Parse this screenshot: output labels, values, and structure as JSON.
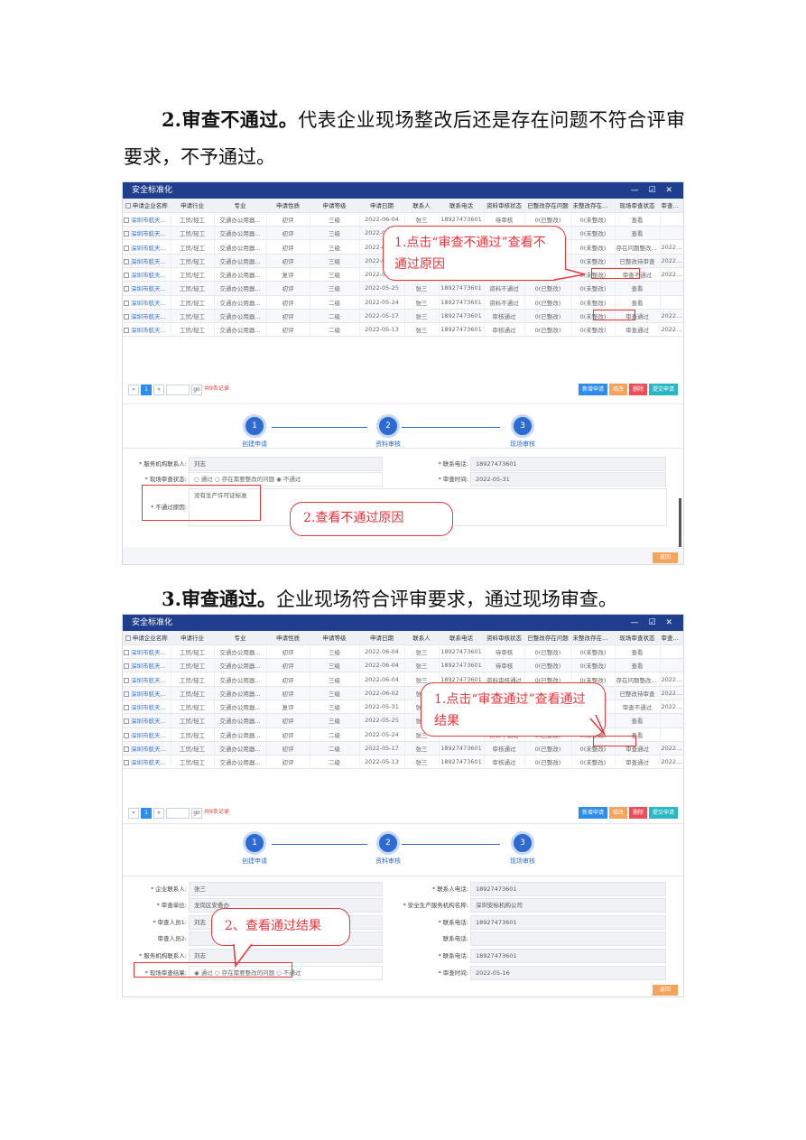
{
  "sections": [
    {
      "num": "2.",
      "bold": "审查不通过。",
      "text": "代表企业现场整改后还是存在问题不符合评审要求，不予通过。"
    },
    {
      "num": "3.",
      "bold": "审查通过。",
      "text": "企业现场符合评审要求，通过现场审查。"
    }
  ],
  "window": {
    "title": "安全标准化",
    "controls": "— ☑ ✕",
    "columns": [
      "申请企业名称",
      "申请行业",
      "专业",
      "申请性质",
      "申请等级",
      "申请日期",
      "联系人",
      "联系电话",
      "资料审核状态",
      "已整改存在问题",
      "未整改存在问题",
      "现场审查状态",
      "审查时间"
    ]
  },
  "table1": [
    [
      "深圳市航天科...",
      "工贸/轻工",
      "交通办公用器...",
      "初评",
      "三级",
      "2022-06-04",
      "张三",
      "18927473601",
      "待审核",
      "0(已整改)",
      "0(未整改)",
      "查看",
      "",
      "blue"
    ],
    [
      "深圳市航天科...",
      "工贸/轻工",
      "交通办公用器...",
      "初评",
      "三级",
      "2022-06-04",
      "张三",
      "18927473601",
      "待审核",
      "0(已整改)",
      "0(未整改)",
      "查看",
      "",
      "blue"
    ],
    [
      "深圳市航天科...",
      "工贸/轻工",
      "交通办公用器...",
      "初评",
      "三级",
      "2022-06-04",
      "张三",
      "18927473601",
      "资料审核通过",
      "0(已整改)",
      "0(未整改)",
      "存在问题整改不通",
      "2022-06-01",
      "blue"
    ],
    [
      "深圳市航天科...",
      "工贸/轻工",
      "交通办公用器...",
      "初评",
      "三级",
      "2022-06-02",
      "张三",
      "18927473601",
      "资料审核通过",
      "0(已整改)",
      "0(未整改)",
      "已整改待审查",
      "2022-06-01",
      "blue"
    ],
    [
      "深圳市航天科...",
      "工贸/轻工",
      "交通办公用器...",
      "复评",
      "三级",
      "2022-05-31",
      "张三",
      "18927473601",
      "资料审核通过",
      "0(已整改)",
      "0(未整改)",
      "审查不通过",
      "2022-05-31",
      "red"
    ],
    [
      "深圳市航天科...",
      "工贸/轻工",
      "交通办公用器...",
      "初评",
      "三级",
      "2022-05-25",
      "张三",
      "18927473601",
      "资料不通过",
      "0(已整改)",
      "0(未整改)",
      "查看",
      "",
      "blue"
    ],
    [
      "深圳市航天科...",
      "工贸/轻工",
      "交通办公用器...",
      "初评",
      "二级",
      "2022-05-24",
      "张三",
      "18927473601",
      "资料不通过",
      "0(已整改)",
      "0(未整改)",
      "查看",
      "",
      "blue"
    ],
    [
      "深圳市航天科...",
      "工贸/轻工",
      "交通办公用器...",
      "初评",
      "二级",
      "2022-05-17",
      "张三",
      "18927473601",
      "审核通过",
      "0(已整改)",
      "0(未整改)",
      "审查通过",
      "2022-05-17",
      "red"
    ],
    [
      "深圳市航天科...",
      "工贸/轻工",
      "交通办公用器...",
      "初评",
      "二级",
      "2022-05-13",
      "张三",
      "18927473601",
      "审核通过",
      "0(已整改)",
      "0(未整改)",
      "审查通过",
      "2022-05-16",
      "blue"
    ]
  ],
  "table2": [
    [
      "深圳市航天科...",
      "工贸/轻工",
      "交通办公用器...",
      "初评",
      "三级",
      "2022-06-04",
      "张三",
      "18927473601",
      "待审核",
      "0(已整改)",
      "0(未整改)",
      "查看",
      "",
      "blue"
    ],
    [
      "深圳市航天科...",
      "工贸/轻工",
      "交通办公用器...",
      "初评",
      "三级",
      "2022-06-04",
      "张三",
      "18927473601",
      "待审核",
      "0(已整改)",
      "0(未整改)",
      "查看",
      "",
      "blue"
    ],
    [
      "深圳市航天科...",
      "工贸/轻工",
      "交通办公用器...",
      "初评",
      "三级",
      "2022-06-04",
      "张三",
      "18927473601",
      "资料审核通过",
      "0(已整改)",
      "0(未整改)",
      "存在问题整改不通",
      "2022-06-01",
      "blue"
    ],
    [
      "深圳市航天科...",
      "工贸/轻工",
      "交通办公用器...",
      "初评",
      "三级",
      "2022-06-02",
      "张三",
      "18927473601",
      "资料审核通过",
      "0(已整改)",
      "0(未整改)",
      "已整改待审查",
      "2022-06-01",
      "blue"
    ],
    [
      "深圳市航天科...",
      "工贸/轻工",
      "交通办公用器...",
      "复评",
      "三级",
      "2022-05-31",
      "张三",
      "18927473601",
      "资料审核通过",
      "0(已整改)",
      "0(未整改)",
      "审查不通过",
      "2022-05-31",
      "blue"
    ],
    [
      "深圳市航天科...",
      "工贸/轻工",
      "交通办公用器...",
      "初评",
      "三级",
      "2022-05-25",
      "张三",
      "18927473601",
      "资料不通过",
      "0(已整改)",
      "0(未整改)",
      "查看",
      "",
      "blue"
    ],
    [
      "深圳市航天科...",
      "工贸/轻工",
      "交通办公用器...",
      "初评",
      "二级",
      "2022-05-24",
      "张三",
      "18927473601",
      "资料不通过",
      "0(已整改)",
      "0(未整改)",
      "查看",
      "",
      "blue"
    ],
    [
      "深圳市航天科...",
      "工贸/轻工",
      "交通办公用器...",
      "初评",
      "二级",
      "2022-05-17",
      "张三",
      "18927473601",
      "审核通过",
      "0(已整改)",
      "0(未整改)",
      "审查通过",
      "2022-05-17",
      "red"
    ],
    [
      "深圳市航天科...",
      "工贸/轻工",
      "交通办公用器...",
      "初评",
      "二级",
      "2022-05-13",
      "张三",
      "18927473601",
      "审核通过",
      "0(已整改)",
      "0(未整改)",
      "审查通过",
      "2022-05-16",
      "blue"
    ]
  ],
  "pager": {
    "prev": "«",
    "page": "1",
    "next": "»",
    "go": "go",
    "total": "共9条记录"
  },
  "buttons": [
    {
      "label": "新增申请",
      "color": "#2d8cf0"
    },
    {
      "label": "修改",
      "color": "#f5a45b"
    },
    {
      "label": "删除",
      "color": "#ed4c58"
    },
    {
      "label": "提交申请",
      "color": "#28b7c4"
    }
  ],
  "steps": [
    "创建申请",
    "资料审核",
    "现场审核"
  ],
  "form1": {
    "row1": {
      "label": "* 服务机构联系人:",
      "value": "刘志",
      "label2": "* 联系电话:",
      "value2": "18927473601"
    },
    "row2": {
      "label": "* 现场审查状态:",
      "opt1": "通过",
      "opt2": "存在需要整改的问题",
      "opt3": "不通过",
      "label2": "* 审查时间:",
      "value2": "2022-05-31"
    },
    "row3": {
      "label": "* 不通过原因:",
      "value": "没有生产许可证标准"
    }
  },
  "form2": {
    "rows": [
      {
        "label": "* 企业联系人:",
        "value": "张三",
        "label2": "* 联系人电话:",
        "value2": "18927473601"
      },
      {
        "label": "* 审查单位:",
        "value": "龙岗区安委办",
        "label2": "* 安全生产服务机构名称:",
        "value2": "深圳安标机构公司"
      },
      {
        "label": "* 审查人员1:",
        "value": "刘志",
        "label2": "* 联系电话:",
        "value2": "18927473601"
      },
      {
        "label": "审查人员2:",
        "value": "",
        "label2": "联系电话:",
        "value2": ""
      },
      {
        "label": "* 服务机构联系人:",
        "value": "刘志",
        "label2": "* 联系电话:",
        "value2": "18927473601"
      }
    ],
    "result": {
      "label": "* 现场审查结果:",
      "opt1": "通过",
      "opt2": "存在需要整改的问题",
      "opt3": "不通过",
      "label2": "* 审查时间:",
      "value2": "2022-05-16"
    }
  },
  "back_label": "返回",
  "callouts": {
    "c1": "1.点击“审查不通过”查看不通过原因",
    "c2": "2.查看不通过原因",
    "c3": "1.点击“审查通过”查看通过结果",
    "c4": "2、查看通过结果"
  }
}
